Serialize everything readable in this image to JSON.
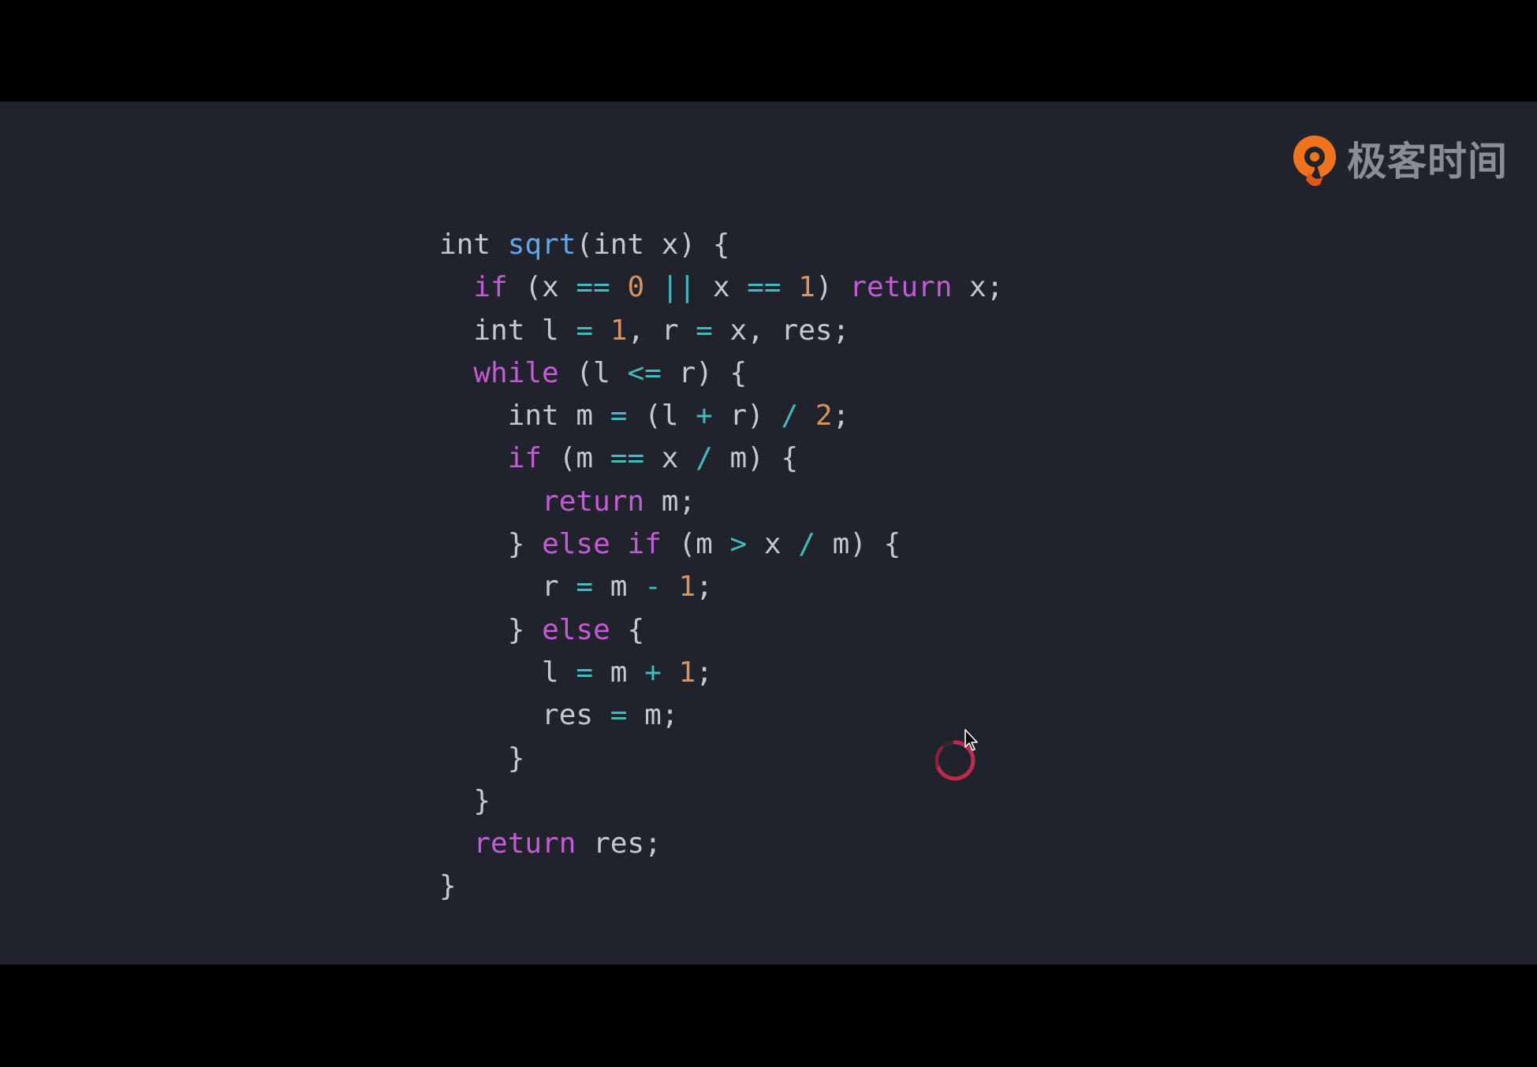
{
  "brand": {
    "name": "极客时间",
    "logo_icon": "geektime-logo-icon",
    "accent": "#f0741e"
  },
  "colors": {
    "background": "#20232b",
    "letterbox": "#000000",
    "keyword": "#c45bd6",
    "function": "#61a8e8",
    "number": "#d7935a",
    "operator": "#3fbcc0",
    "text": "#c5c8ce"
  },
  "code": {
    "language": "c",
    "lines": [
      {
        "indent": 0,
        "tokens": [
          [
            "txt",
            "int "
          ],
          [
            "fn",
            "sqrt"
          ],
          [
            "txt",
            "(int x) {"
          ]
        ]
      },
      {
        "indent": 1,
        "tokens": [
          [
            "kw",
            "if"
          ],
          [
            "txt",
            " (x "
          ],
          [
            "op",
            "=="
          ],
          [
            "txt",
            " "
          ],
          [
            "num",
            "0"
          ],
          [
            "txt",
            " "
          ],
          [
            "op",
            "||"
          ],
          [
            "txt",
            " x "
          ],
          [
            "op",
            "=="
          ],
          [
            "txt",
            " "
          ],
          [
            "num",
            "1"
          ],
          [
            "txt",
            ") "
          ],
          [
            "kw",
            "return"
          ],
          [
            "txt",
            " x;"
          ]
        ]
      },
      {
        "indent": 1,
        "tokens": [
          [
            "txt",
            "int l "
          ],
          [
            "op",
            "="
          ],
          [
            "txt",
            " "
          ],
          [
            "num",
            "1"
          ],
          [
            "txt",
            ", r "
          ],
          [
            "op",
            "="
          ],
          [
            "txt",
            " x, res;"
          ]
        ]
      },
      {
        "indent": 1,
        "tokens": [
          [
            "kw",
            "while"
          ],
          [
            "txt",
            " (l "
          ],
          [
            "op",
            "<="
          ],
          [
            "txt",
            " r) {"
          ]
        ]
      },
      {
        "indent": 2,
        "tokens": [
          [
            "txt",
            "int m "
          ],
          [
            "op",
            "="
          ],
          [
            "txt",
            " (l "
          ],
          [
            "op",
            "+"
          ],
          [
            "txt",
            " r) "
          ],
          [
            "op",
            "/"
          ],
          [
            "txt",
            " "
          ],
          [
            "num",
            "2"
          ],
          [
            "txt",
            ";"
          ]
        ]
      },
      {
        "indent": 2,
        "tokens": [
          [
            "kw",
            "if"
          ],
          [
            "txt",
            " (m "
          ],
          [
            "op",
            "=="
          ],
          [
            "txt",
            " x "
          ],
          [
            "op",
            "/"
          ],
          [
            "txt",
            " m) {"
          ]
        ]
      },
      {
        "indent": 3,
        "tokens": [
          [
            "kw",
            "return"
          ],
          [
            "txt",
            " m;"
          ]
        ]
      },
      {
        "indent": 2,
        "tokens": [
          [
            "txt",
            "} "
          ],
          [
            "kw",
            "else"
          ],
          [
            "txt",
            " "
          ],
          [
            "kw",
            "if"
          ],
          [
            "txt",
            " (m "
          ],
          [
            "op",
            ">"
          ],
          [
            "txt",
            " x "
          ],
          [
            "op",
            "/"
          ],
          [
            "txt",
            " m) {"
          ]
        ]
      },
      {
        "indent": 3,
        "tokens": [
          [
            "txt",
            "r "
          ],
          [
            "op",
            "="
          ],
          [
            "txt",
            " m "
          ],
          [
            "op",
            "-"
          ],
          [
            "txt",
            " "
          ],
          [
            "num",
            "1"
          ],
          [
            "txt",
            ";"
          ]
        ]
      },
      {
        "indent": 2,
        "tokens": [
          [
            "txt",
            "} "
          ],
          [
            "kw",
            "else"
          ],
          [
            "txt",
            " {"
          ]
        ]
      },
      {
        "indent": 3,
        "tokens": [
          [
            "txt",
            "l "
          ],
          [
            "op",
            "="
          ],
          [
            "txt",
            " m "
          ],
          [
            "op",
            "+"
          ],
          [
            "txt",
            " "
          ],
          [
            "num",
            "1"
          ],
          [
            "txt",
            ";"
          ]
        ]
      },
      {
        "indent": 3,
        "tokens": [
          [
            "txt",
            "res "
          ],
          [
            "op",
            "="
          ],
          [
            "txt",
            " m;"
          ]
        ]
      },
      {
        "indent": 2,
        "tokens": [
          [
            "txt",
            "}"
          ]
        ]
      },
      {
        "indent": 1,
        "tokens": [
          [
            "txt",
            "}"
          ]
        ]
      },
      {
        "indent": 1,
        "tokens": [
          [
            "kw",
            "return"
          ],
          [
            "txt",
            " res;"
          ]
        ]
      },
      {
        "indent": 0,
        "tokens": [
          [
            "txt",
            "}"
          ]
        ]
      }
    ]
  },
  "overlay": {
    "spinner_icon": "loading-spinner-icon",
    "cursor_icon": "mouse-cursor-icon",
    "spinner_color": "#c0284e"
  }
}
